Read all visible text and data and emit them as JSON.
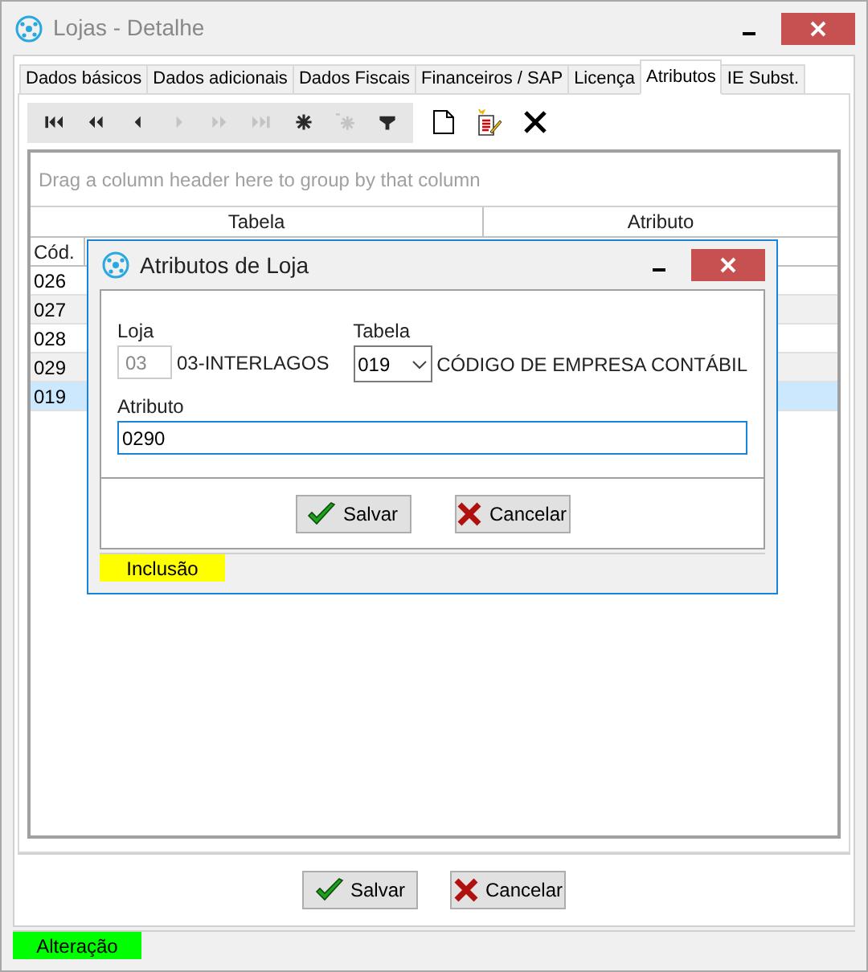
{
  "window": {
    "title": "Lojas - Detalhe"
  },
  "tabs": [
    {
      "label": "Dados básicos",
      "selected": false
    },
    {
      "label": "Dados adicionais",
      "selected": false
    },
    {
      "label": "Dados Fiscais",
      "selected": false
    },
    {
      "label": "Financeiros / SAP",
      "selected": false
    },
    {
      "label": "Licença",
      "selected": false
    },
    {
      "label": "Atributos",
      "selected": true
    },
    {
      "label": "IE Subst.",
      "selected": false
    }
  ],
  "toolbar": {
    "navigator": [
      {
        "kind": "first",
        "disabled": false
      },
      {
        "kind": "prev-page",
        "disabled": false
      },
      {
        "kind": "prev",
        "disabled": false
      },
      {
        "kind": "next",
        "disabled": true
      },
      {
        "kind": "next-page",
        "disabled": true
      },
      {
        "kind": "last",
        "disabled": true
      },
      {
        "kind": "star",
        "disabled": false
      },
      {
        "kind": "star-plus",
        "disabled": true
      },
      {
        "kind": "filter",
        "disabled": false
      }
    ],
    "actions": [
      {
        "kind": "new"
      },
      {
        "kind": "edit"
      },
      {
        "kind": "delete"
      }
    ]
  },
  "grid": {
    "group_hint": "Drag a column header here to group by that column",
    "bands": [
      "Tabela",
      "Atributo"
    ],
    "columns": [
      "Cód."
    ],
    "rows": [
      {
        "cod": "026",
        "selected": false
      },
      {
        "cod": "027",
        "selected": false
      },
      {
        "cod": "028",
        "selected": false
      },
      {
        "cod": "029",
        "selected": false
      },
      {
        "cod": "019",
        "selected": true
      }
    ]
  },
  "buttons": [
    {
      "kind": "save",
      "label": "Salvar"
    },
    {
      "kind": "cancel",
      "label": "Cancelar"
    }
  ],
  "status_bar": {
    "text": "Alteração",
    "color": "#00ff00"
  },
  "dialog": {
    "title": "Atributos de Loja",
    "loja": {
      "label": "Loja",
      "code": "03",
      "name": "03-INTERLAGOS"
    },
    "tabela": {
      "label": "Tabela",
      "value": "019",
      "description": "CÓDIGO DE EMPRESA CONTÁBIL"
    },
    "atributo": {
      "label": "Atributo",
      "value": "0290"
    },
    "buttons": [
      {
        "kind": "save",
        "label": "Salvar"
      },
      {
        "kind": "cancel",
        "label": "Cancelar"
      }
    ],
    "status_bar": {
      "text": "Inclusão",
      "color": "#ffff00"
    }
  }
}
